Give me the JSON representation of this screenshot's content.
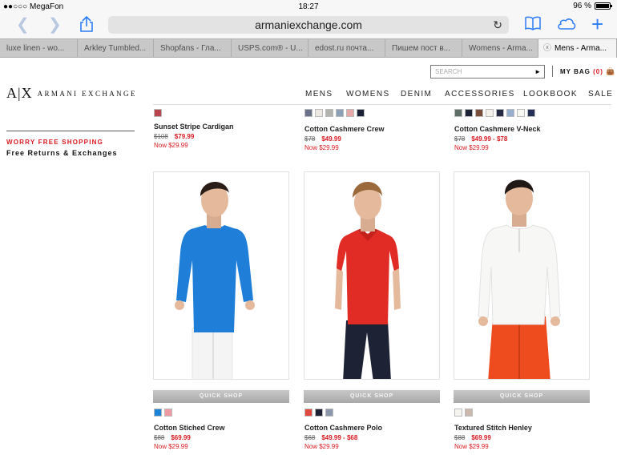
{
  "status_bar": {
    "carrier": "●●○○○ MegaFon",
    "time": "18:27",
    "battery": "96 %"
  },
  "browser": {
    "url": "armaniexchange.com"
  },
  "tabs": [
    {
      "label": "luxe linen - wo..."
    },
    {
      "label": "Arkley Tumbled..."
    },
    {
      "label": "Shopfans - Гла..."
    },
    {
      "label": "USPS.com® - U..."
    },
    {
      "label": "edost.ru почта..."
    },
    {
      "label": "Пишем пост в..."
    },
    {
      "label": "Womens - Arma..."
    },
    {
      "label": "Mens - Arma..."
    }
  ],
  "site": {
    "logo_mark": "A|X",
    "logo_text": "ARMANI EXCHANGE",
    "search_placeholder": "SEARCH",
    "search_go": "►",
    "bag_label": "MY BAG",
    "bag_count": "(0)",
    "nav": [
      "MENS",
      "WOMENS",
      "DENIM",
      "ACCESSORIES",
      "LOOKBOOK",
      "SALE"
    ],
    "promo_title": "WORRY FREE SHOPPING",
    "promo_sub": "Free Returns & Exchanges",
    "quick_shop": "QUICK SHOP"
  },
  "top_products": [
    {
      "name": "Sunset Stripe Cardigan",
      "old_price": "$108",
      "price": "$79.99",
      "now": "Now $29.99",
      "swatches": [
        "#b8454c"
      ]
    },
    {
      "name": "Cotton Cashmere Crew",
      "old_price": "$78",
      "price": "$49.99",
      "now": "Now $29.99",
      "swatches": [
        "#6a7289",
        "#ebe9e1",
        "#b3b3b0",
        "#8ea0b5",
        "#e6a8a6",
        "#1b2238"
      ]
    },
    {
      "name": "Cotton Cashmere V-Neck",
      "old_price": "$78",
      "price": "$49.99 - $78",
      "now": "Now $29.99",
      "swatches": [
        "#5f6f68",
        "#1d2436",
        "#7b4e3b",
        "#f4f1ea",
        "#232a41",
        "#95aed0",
        "#f7f7f4",
        "#243057"
      ]
    }
  ],
  "bottom_products": [
    {
      "name": "Cotton Stiched Crew",
      "old_price": "$88",
      "price": "$69.99",
      "now": "Now $29.99",
      "swatches": [
        "#1d83d7",
        "#ee9aa3"
      ],
      "image": "blue-crew-sweater"
    },
    {
      "name": "Cotton Cashmere Polo",
      "old_price": "$68",
      "price": "$49.99 - $68",
      "now": "Now $29.99",
      "swatches": [
        "#e0493f",
        "#1d2234",
        "#8a97ad"
      ],
      "image": "red-polo-shirt"
    },
    {
      "name": "Textured Stitch Henley",
      "old_price": "$88",
      "price": "$69.99",
      "now": "Now $29.99",
      "swatches": [
        "#f6f4ef",
        "#cbb9ae"
      ],
      "image": "white-henley-shirt"
    }
  ]
}
